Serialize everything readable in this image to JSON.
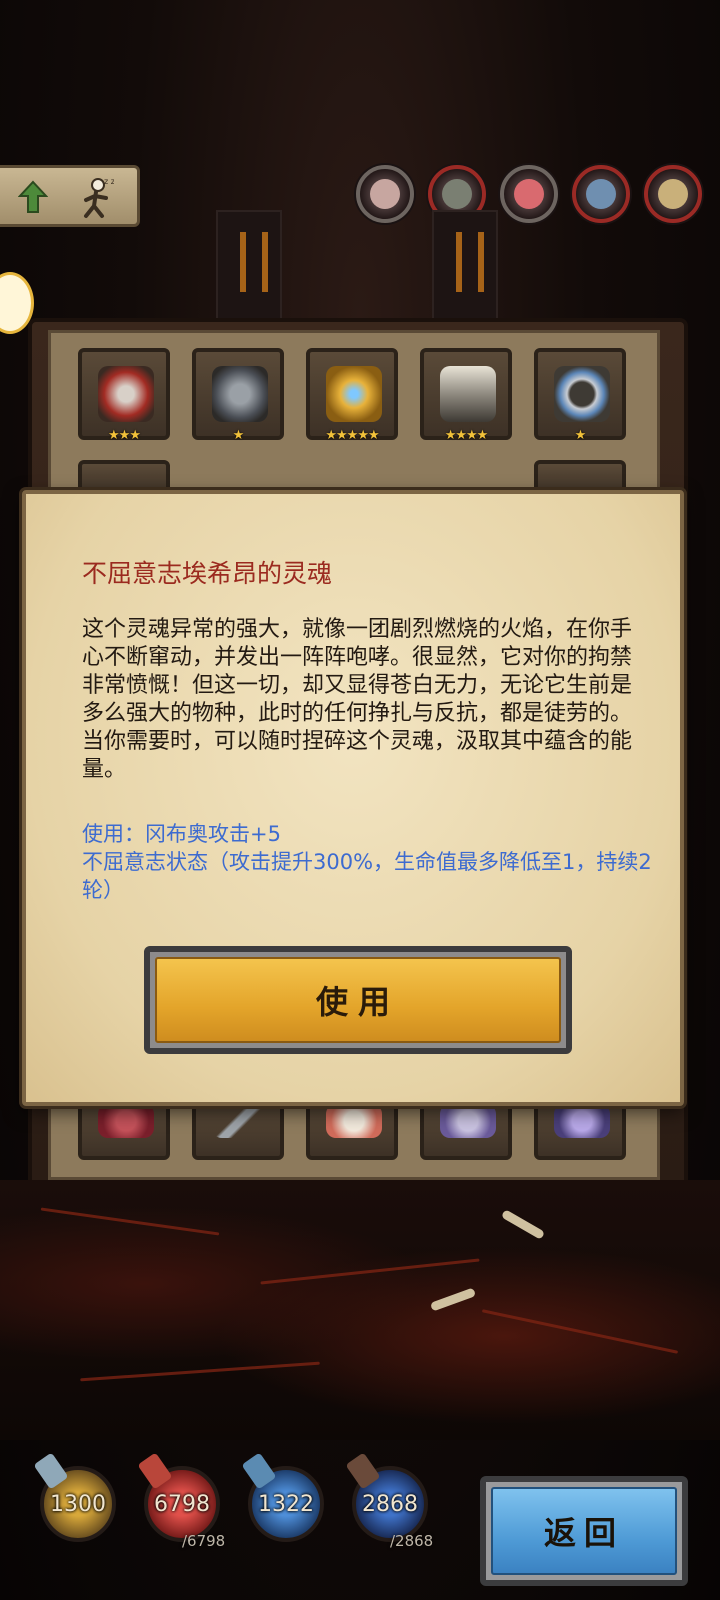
{
  "top_bar": {
    "tokens": [
      "monster-token-1",
      "monster-token-2",
      "monster-token-3",
      "monster-token-4",
      "monster-token-5"
    ]
  },
  "inventory": {
    "row1": [
      {
        "icon": "bracer-icon",
        "stars": "★★★"
      },
      {
        "icon": "armor-icon",
        "stars": "★"
      },
      {
        "icon": "horned-helmet-icon",
        "stars": "★★★★★"
      },
      {
        "icon": "chest-icon",
        "stars": "★★★★"
      },
      {
        "icon": "ring-icon",
        "stars": "★"
      }
    ]
  },
  "dialog": {
    "title": "不屈意志埃希昂的灵魂",
    "description": "这个灵魂异常的强大，就像一团剧烈燃烧的火焰，在你手心不断窜动，并发出一阵阵咆哮。很显然，它对你的拘禁非常愤慨！但这一切，却又显得苍白无力，无论它生前是多么强大的物种，此时的任何挣扎与反抗，都是徒劳的。当你需要时，可以随时捏碎这个灵魂，汲取其中蕴含的能量。",
    "effect_line1": "使用：冈布奥攻击+5",
    "effect_line2": "不屈意志状态（攻击提升300%，生命值最多降低至1，持续2轮）",
    "use_button": "使用"
  },
  "stats": {
    "attack": "1300",
    "hp": "6798",
    "hp_max": "/6798",
    "magic": "1322",
    "mp": "2868",
    "mp_max": "/2868"
  },
  "back_button": "返回",
  "colors": {
    "title_red": "#9b2a1f",
    "effect_blue": "#3d6bd0",
    "use_button_gold": "#e3a42a",
    "back_button_blue": "#4f9bd6"
  }
}
